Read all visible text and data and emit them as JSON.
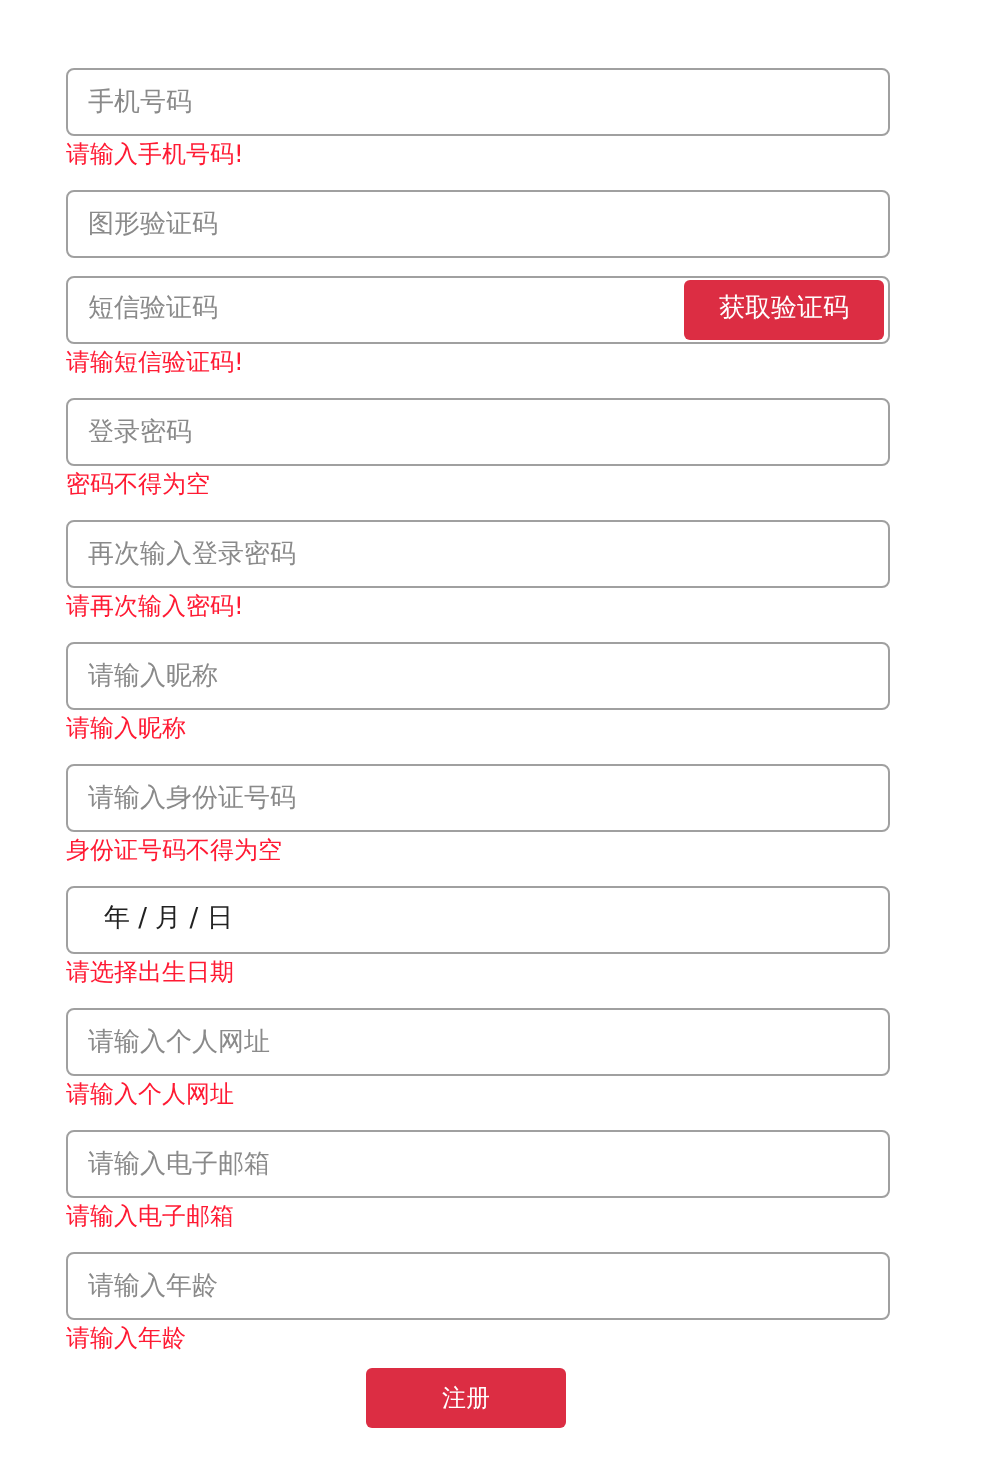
{
  "fields": [
    {
      "kind": "text",
      "placeholder": "手机号码",
      "error": "请输入手机号码!"
    },
    {
      "kind": "text",
      "placeholder": "图形验证码"
    },
    {
      "kind": "sms",
      "placeholder": "短信验证码",
      "button": "获取验证码",
      "error": "请输短信验证码!"
    },
    {
      "kind": "text",
      "placeholder": "登录密码",
      "error": "密码不得为空"
    },
    {
      "kind": "text",
      "placeholder": "再次输入登录密码",
      "error": "请再次输入密码!"
    },
    {
      "kind": "text",
      "placeholder": "请输入昵称",
      "error": "请输入昵称"
    },
    {
      "kind": "text",
      "placeholder": "请输入身份证号码",
      "error": "身份证号码不得为空"
    },
    {
      "kind": "date",
      "value": "年 / 月 / 日",
      "error": "请选择出生日期"
    },
    {
      "kind": "text",
      "placeholder": "请输入个人网址",
      "error": "请输入个人网址"
    },
    {
      "kind": "text",
      "placeholder": "请输入电子邮箱",
      "error": "请输入电子邮箱"
    },
    {
      "kind": "text",
      "placeholder": "请输入年龄",
      "error": "请输入年龄"
    }
  ],
  "submit": "注册"
}
